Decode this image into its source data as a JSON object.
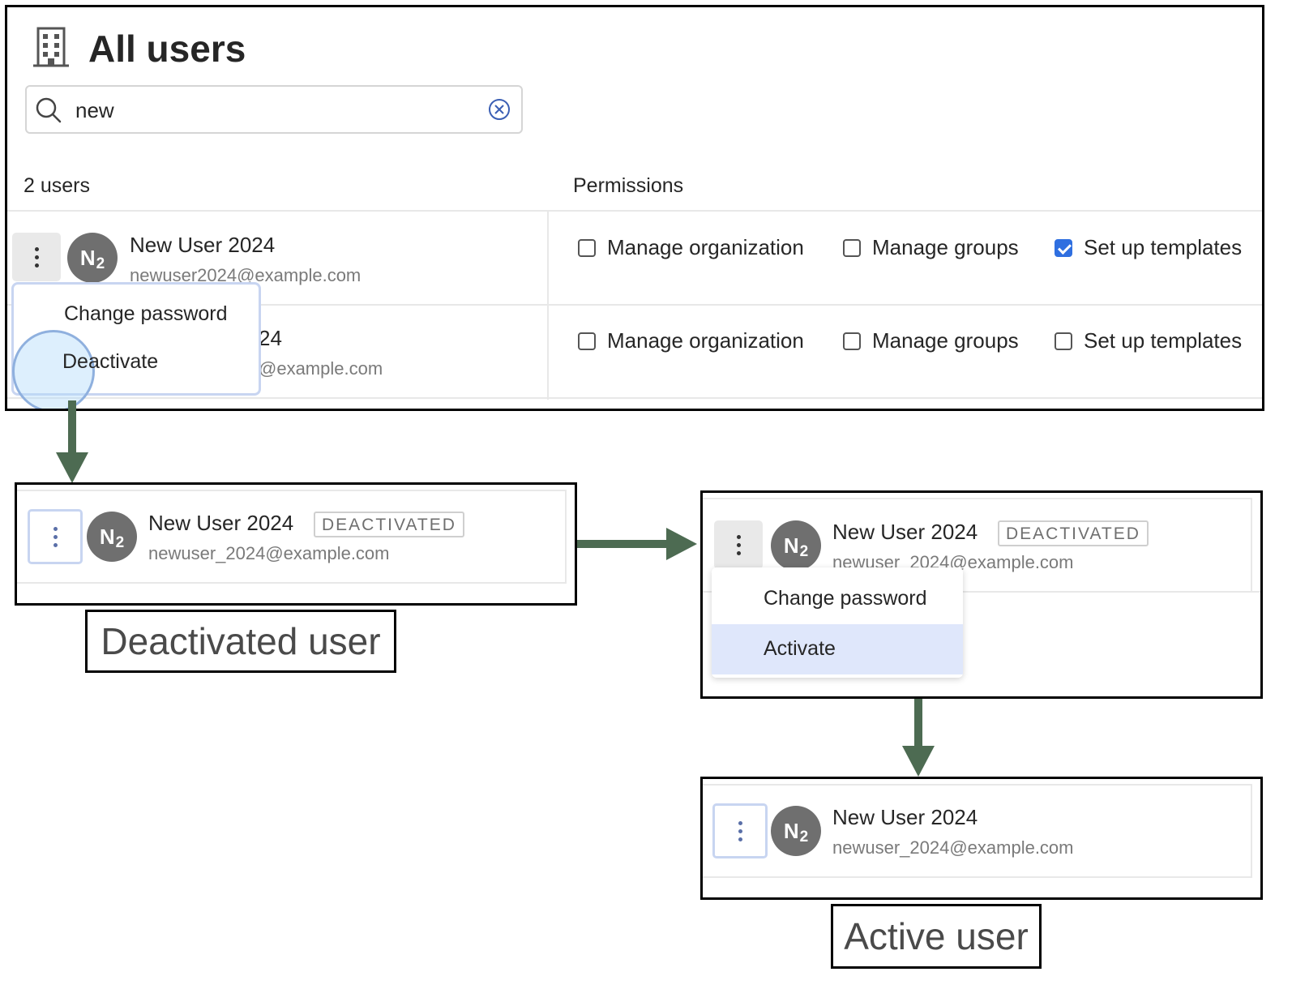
{
  "top_panel": {
    "title": "All users",
    "title_icon": "building-icon",
    "search": {
      "value": "new",
      "placeholder": "",
      "icon": "search-icon",
      "clear_icon": "clear-circle-x-icon"
    },
    "users_count": "2 users",
    "permissions_header": "Permissions",
    "rows": [
      {
        "avatar": {
          "letter": "N",
          "subscript": "2"
        },
        "name": "New User 2024",
        "email": "newuser2024@example.com",
        "permissions": [
          {
            "label": "Manage organization",
            "checked": false
          },
          {
            "label": "Manage groups",
            "checked": false
          },
          {
            "label": "Set up templates",
            "checked": true
          }
        ]
      },
      {
        "name_visible_fragment": "24",
        "email_visible_fragment": "@example.com",
        "permissions": [
          {
            "label": "Manage organization",
            "checked": false
          },
          {
            "label": "Manage groups",
            "checked": false
          },
          {
            "label": "Set up templates",
            "checked": false
          }
        ]
      }
    ],
    "menu": {
      "items": [
        "Change password",
        "Deactivate"
      ]
    }
  },
  "deactivated_panel": {
    "avatar": {
      "letter": "N",
      "subscript": "2"
    },
    "name": "New User 2024",
    "badge": "DEACTIVATED",
    "email": "newuser_2024@example.com",
    "caption": "Deactivated user"
  },
  "menu_panel": {
    "avatar": {
      "letter": "N",
      "subscript": "2"
    },
    "name": "New User 2024",
    "badge": "DEACTIVATED",
    "email": "newuser_2024@example.com",
    "menu": {
      "items": [
        "Change password",
        "Activate"
      ],
      "highlighted": "Activate"
    }
  },
  "active_panel": {
    "avatar": {
      "letter": "N",
      "subscript": "2"
    },
    "name": "New User 2024",
    "email": "newuser_2024@example.com",
    "caption": "Active user"
  },
  "colors": {
    "arrow": "#4d6b52",
    "checkbox_checked": "#2f6fe0",
    "menu_highlight": "#dfe7fb",
    "avatar_bg": "#6f6f6f",
    "focus_outline": "#c8d5f1"
  }
}
